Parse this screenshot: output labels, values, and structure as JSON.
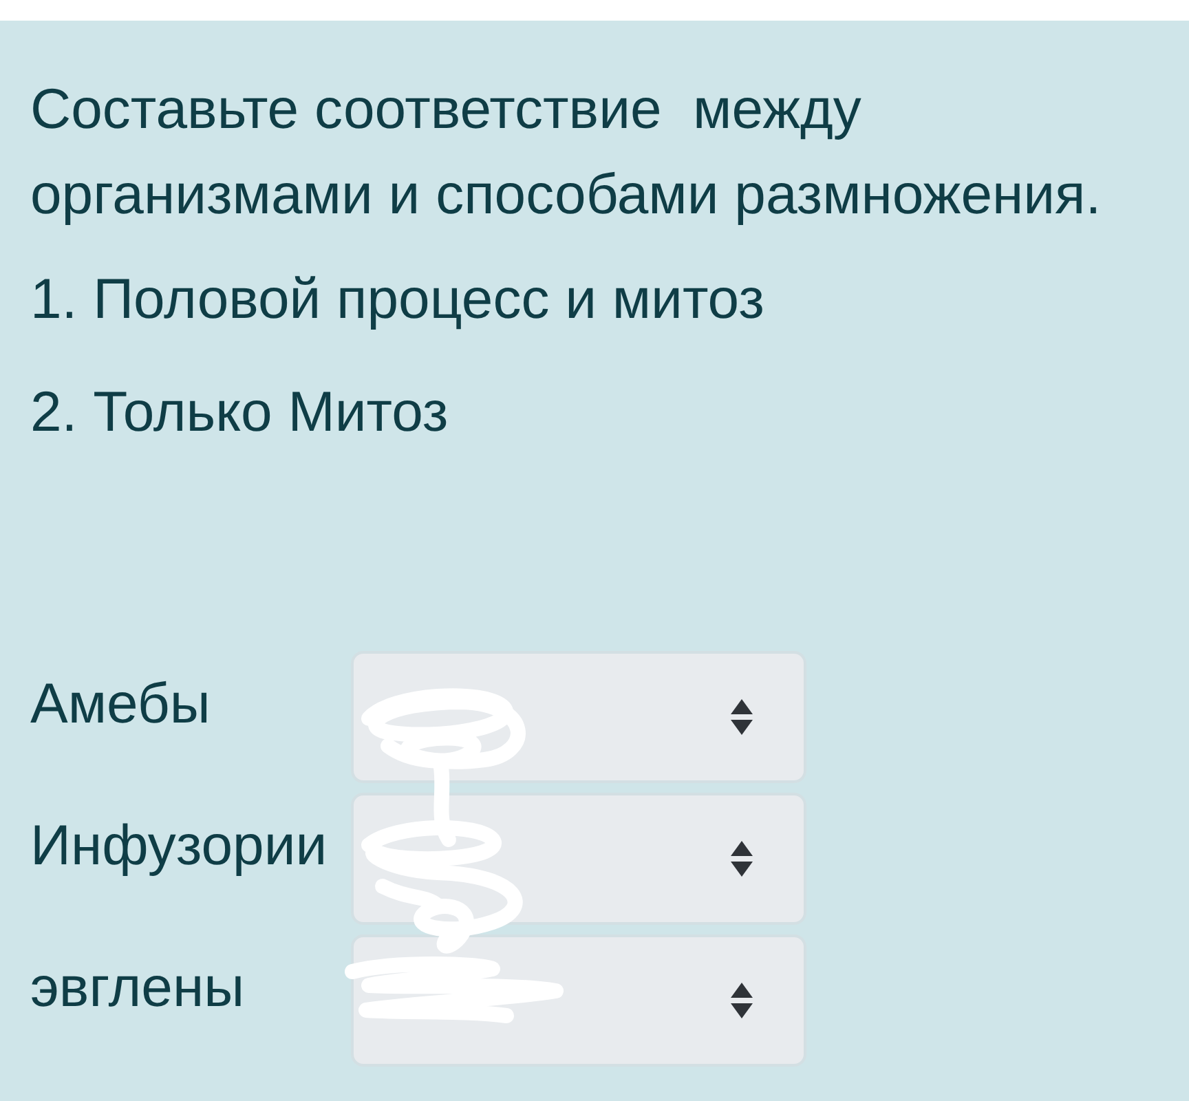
{
  "question": {
    "text": "Составьте соответствие  между организмами и способами размножения."
  },
  "options": [
    "1. Половой процесс и митоз",
    "2. Только Митоз"
  ],
  "matches": [
    {
      "label": "Амебы"
    },
    {
      "label": "Инфузории"
    },
    {
      "label": "эвглены"
    }
  ]
}
